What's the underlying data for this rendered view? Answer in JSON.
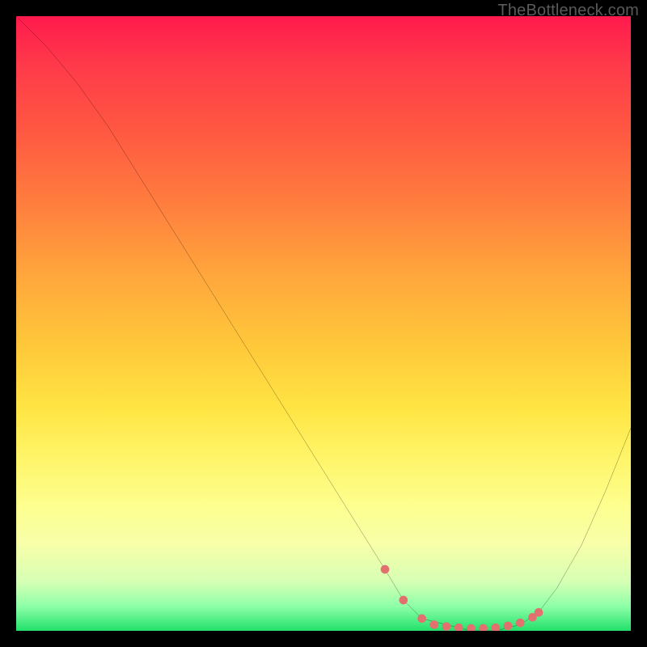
{
  "watermark": "TheBottleneck.com",
  "chart_data": {
    "type": "line",
    "title": "",
    "xlabel": "",
    "ylabel": "",
    "xlim": [
      0,
      100
    ],
    "ylim": [
      0,
      100
    ],
    "series": [
      {
        "name": "bottleneck-curve",
        "x": [
          0,
          5,
          10,
          15,
          20,
          25,
          30,
          35,
          40,
          45,
          50,
          55,
          60,
          63,
          66,
          70,
          74,
          78,
          82,
          85,
          88,
          92,
          96,
          100
        ],
        "y": [
          100,
          95,
          89,
          82,
          74,
          66,
          58,
          50,
          42,
          34,
          26,
          18,
          10,
          5,
          2,
          1,
          0,
          0,
          1,
          3,
          7,
          14,
          23,
          33
        ]
      }
    ],
    "highlight_segment": {
      "name": "valley-markers",
      "color": "#e2706f",
      "x": [
        60,
        63,
        66,
        68,
        70,
        72,
        74,
        76,
        78,
        80,
        82,
        84,
        85
      ],
      "y": [
        10,
        5,
        2,
        1,
        0.7,
        0.5,
        0.4,
        0.4,
        0.5,
        0.8,
        1.3,
        2.2,
        3
      ]
    },
    "background_gradient": {
      "top": "#ff1a4d",
      "mid": "#ffe544",
      "bottom": "#22e06a"
    }
  }
}
